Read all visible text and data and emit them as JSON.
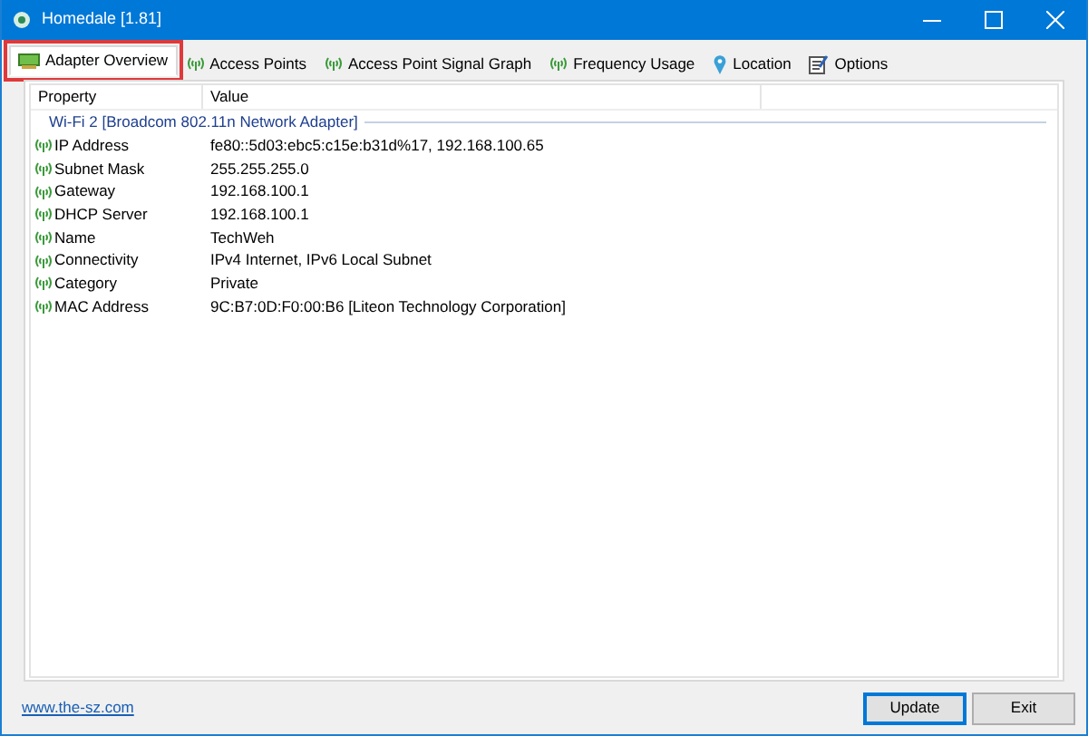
{
  "window": {
    "title": "Homedale [1.81]"
  },
  "tabs": [
    {
      "label": "Adapter Overview",
      "kind": "adapter",
      "selected": true,
      "highlighted": true
    },
    {
      "label": "Access Points",
      "kind": "signal",
      "selected": false,
      "highlighted": false
    },
    {
      "label": "Access Point Signal Graph",
      "kind": "signal",
      "selected": false,
      "highlighted": false
    },
    {
      "label": "Frequency Usage",
      "kind": "signal",
      "selected": false,
      "highlighted": false
    },
    {
      "label": "Location",
      "kind": "pin",
      "selected": false,
      "highlighted": false
    },
    {
      "label": "Options",
      "kind": "options",
      "selected": false,
      "highlighted": false
    }
  ],
  "table": {
    "columns": [
      "Property",
      "Value"
    ],
    "group": "Wi-Fi 2 [Broadcom 802.11n Network Adapter]",
    "rows": [
      {
        "property": "IP Address",
        "value": "fe80::5d03:ebc5:c15e:b31d%17, 192.168.100.65"
      },
      {
        "property": "Subnet Mask",
        "value": "255.255.255.0"
      },
      {
        "property": "Gateway",
        "value": "192.168.100.1"
      },
      {
        "property": "DHCP Server",
        "value": "192.168.100.1"
      },
      {
        "property": "Name",
        "value": "TechWeh"
      },
      {
        "property": "Connectivity",
        "value": "IPv4 Internet, IPv6 Local Subnet"
      },
      {
        "property": "Category",
        "value": "Private"
      },
      {
        "property": "MAC Address",
        "value": "9C:B7:0D:F0:00:B6 [Liteon Technology Corporation]"
      }
    ]
  },
  "footer": {
    "link": "www.the-sz.com",
    "buttons": [
      {
        "label": "Update",
        "default": true
      },
      {
        "label": "Exit",
        "default": false
      }
    ]
  }
}
